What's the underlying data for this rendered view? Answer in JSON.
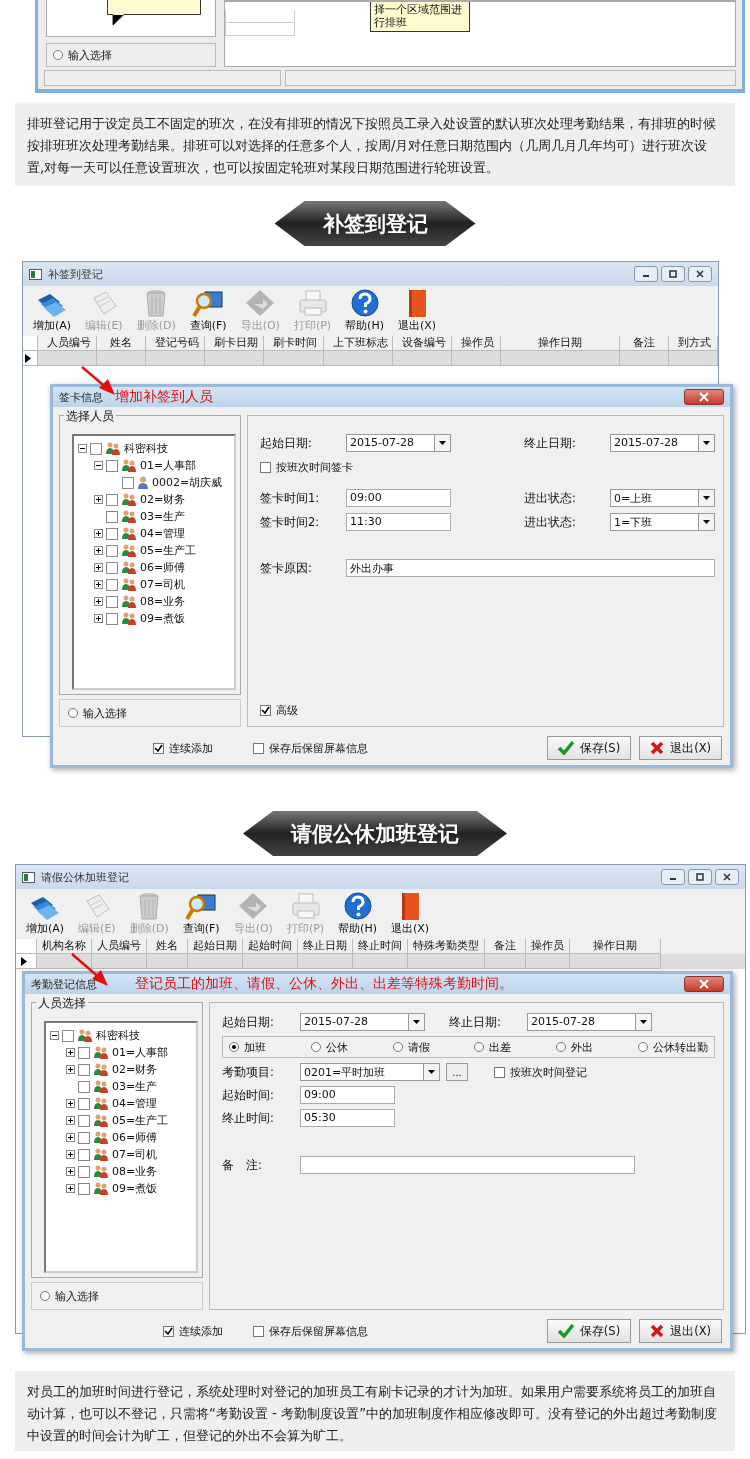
{
  "top_fragment": {
    "callout": "择一个区域范围进行排班",
    "input_select": {
      "label": "输入选择",
      "selected": false
    }
  },
  "intro_text": "排班登记用于设定员工不固定的班次，在没有排班的情况下按照员工录入处设置的默认班次处理考勤结果，有排班的时候按排班班次处理考勤结果。排班可以对选择的任意多个人，按周/月对任意日期范围内（几周几月几年均可）进行班次设置,对每一天可以任意设置班次，也可以按固定轮班对某段日期范围进行轮班设置。",
  "sections": [
    {
      "banner": "补签到登记",
      "window": {
        "title": "补签到登记",
        "toolbar": [
          {
            "kind": "add",
            "label": "增加(A)",
            "disabled": false
          },
          {
            "kind": "edit",
            "label": "编辑(E)",
            "disabled": true
          },
          {
            "kind": "delete",
            "label": "删除(D)",
            "disabled": true
          },
          {
            "kind": "query",
            "label": "查询(F)",
            "disabled": false
          },
          {
            "kind": "export",
            "label": "导出(O)",
            "disabled": true
          },
          {
            "kind": "print",
            "label": "打印(P)",
            "disabled": true
          },
          {
            "kind": "help",
            "label": "帮助(H)",
            "disabled": false
          },
          {
            "kind": "exit",
            "label": "退出(X)",
            "disabled": false
          }
        ],
        "columns": [
          "人员编号",
          "姓名",
          "登记号码",
          "刷卡日期",
          "刷卡时间",
          "上下班标志",
          "设备编号",
          "操作员",
          "操作日期",
          "备注",
          "到方式"
        ]
      },
      "dialog": {
        "title": "签卡信息",
        "annotation": "增加补签到人员",
        "group_label": "选择人员",
        "tree": [
          {
            "label": "科密科技",
            "kind": "dept",
            "expanded": true,
            "checked": false,
            "children": [
              {
                "label": "01=人事部",
                "kind": "dept",
                "expanded": true,
                "checked": false,
                "children": [
                  {
                    "label": "0002=胡庆威",
                    "kind": "person",
                    "checked": false
                  }
                ]
              },
              {
                "label": "02=财务",
                "kind": "dept",
                "expanded": false,
                "checked": false
              },
              {
                "label": "03=生产",
                "kind": "empty_dept",
                "checked": false
              },
              {
                "label": "04=管理",
                "kind": "dept",
                "expanded": false,
                "checked": false
              },
              {
                "label": "05=生产工",
                "kind": "dept",
                "expanded": false,
                "checked": false
              },
              {
                "label": "06=师傅",
                "kind": "dept",
                "expanded": false,
                "checked": false
              },
              {
                "label": "07=司机",
                "kind": "dept",
                "expanded": false,
                "checked": false
              },
              {
                "label": "08=业务",
                "kind": "dept",
                "expanded": false,
                "checked": false
              },
              {
                "label": "09=煮饭",
                "kind": "dept",
                "expanded": false,
                "checked": false
              }
            ]
          }
        ],
        "input_select": {
          "label": "输入选择",
          "selected": false
        },
        "rows": [
          {
            "kind": "pairs",
            "items": [
              {
                "kind": "label",
                "text": "起始日期:"
              },
              {
                "kind": "combo",
                "value": "2015-07-28"
              },
              {
                "kind": "label",
                "text": "终止日期:"
              },
              {
                "kind": "combo",
                "value": "2015-07-28"
              }
            ]
          },
          {
            "kind": "check",
            "items": [
              {
                "kind": "check",
                "label": "按班次时间签卡",
                "checked": false
              }
            ]
          },
          {
            "kind": "pairs",
            "items": [
              {
                "kind": "label",
                "text": "签卡时间1:"
              },
              {
                "kind": "text",
                "value": "09:00"
              },
              {
                "kind": "label",
                "text": "进出状态:"
              },
              {
                "kind": "select",
                "value": "0=上班"
              }
            ]
          },
          {
            "kind": "pairs",
            "items": [
              {
                "kind": "label",
                "text": "签卡时间2:"
              },
              {
                "kind": "text",
                "value": "11:30"
              },
              {
                "kind": "label",
                "text": "进出状态:"
              },
              {
                "kind": "select",
                "value": "1=下班"
              }
            ]
          },
          {
            "kind": "wide",
            "items": [
              {
                "kind": "label",
                "text": "签卡原因:"
              },
              {
                "kind": "text",
                "value": "外出办事"
              }
            ]
          },
          {
            "kind": "bottom",
            "items": [
              {
                "kind": "check",
                "label": "高级",
                "checked": true
              }
            ]
          }
        ],
        "footer_checks": [
          {
            "label": "连续添加",
            "checked": true
          },
          {
            "label": "保存后保留屏幕信息",
            "checked": false
          }
        ],
        "buttons": [
          {
            "kind": "save",
            "label": "保存(S)"
          },
          {
            "kind": "exit",
            "label": "退出(X)"
          }
        ]
      }
    },
    {
      "banner": "请假公休加班登记",
      "window": {
        "title": "请假公休加班登记",
        "toolbar": [
          {
            "kind": "add",
            "label": "增加(A)",
            "disabled": false
          },
          {
            "kind": "edit",
            "label": "编辑(E)",
            "disabled": true
          },
          {
            "kind": "delete",
            "label": "删除(D)",
            "disabled": true
          },
          {
            "kind": "query",
            "label": "查询(F)",
            "disabled": false
          },
          {
            "kind": "export",
            "label": "导出(O)",
            "disabled": true
          },
          {
            "kind": "print",
            "label": "打印(P)",
            "disabled": true
          },
          {
            "kind": "help",
            "label": "帮助(H)",
            "disabled": false
          },
          {
            "kind": "exit",
            "label": "退出(X)",
            "disabled": false
          }
        ],
        "columns": [
          "机构名称",
          "人员编号",
          "姓名",
          "起始日期",
          "起始时间",
          "终止日期",
          "终止时间",
          "特殊考勤类型",
          "备注",
          "操作员",
          "操作日期"
        ]
      },
      "dialog": {
        "title": "考勤登记信息",
        "annotation": "登记员工的加班、请假、公休、外出、出差等特殊考勤时间。",
        "group_label": "人员选择",
        "tree": [
          {
            "label": "科密科技",
            "kind": "dept",
            "expanded": true,
            "checked": false,
            "children": [
              {
                "label": "01=人事部",
                "kind": "dept",
                "expanded": false,
                "checked": false
              },
              {
                "label": "02=财务",
                "kind": "dept",
                "expanded": false,
                "checked": false
              },
              {
                "label": "03=生产",
                "kind": "empty_dept",
                "checked": false
              },
              {
                "label": "04=管理",
                "kind": "dept",
                "expanded": false,
                "checked": false
              },
              {
                "label": "05=生产工",
                "kind": "dept",
                "expanded": false,
                "checked": false
              },
              {
                "label": "06=师傅",
                "kind": "dept",
                "expanded": false,
                "checked": false
              },
              {
                "label": "07=司机",
                "kind": "dept",
                "expanded": false,
                "checked": false
              },
              {
                "label": "08=业务",
                "kind": "dept",
                "expanded": false,
                "checked": false
              },
              {
                "label": "09=煮饭",
                "kind": "dept",
                "expanded": false,
                "checked": false
              }
            ]
          }
        ],
        "input_select": {
          "label": "输入选择",
          "selected": false
        },
        "rows": [
          {
            "kind": "inline",
            "items": [
              {
                "kind": "label",
                "text": "起始日期:"
              },
              {
                "kind": "combo",
                "value": "2015-07-28"
              },
              {
                "kind": "label",
                "text": "终止日期:"
              },
              {
                "kind": "combo",
                "value": "2015-07-28"
              }
            ]
          },
          {
            "kind": "radios",
            "items": [
              {
                "kind": "radio",
                "label": "加班",
                "selected": true
              },
              {
                "kind": "radio",
                "label": "公休",
                "selected": false
              },
              {
                "kind": "radio",
                "label": "请假",
                "selected": false
              },
              {
                "kind": "radio",
                "label": "出差",
                "selected": false
              },
              {
                "kind": "radio",
                "label": "外出",
                "selected": false
              },
              {
                "kind": "radio",
                "label": "公休转出勤",
                "selected": false
              }
            ]
          },
          {
            "kind": "line",
            "items": [
              {
                "kind": "label",
                "text": "考勤项目:"
              },
              {
                "kind": "select",
                "value": "0201=平时加班"
              },
              {
                "kind": "ellipsis",
                "text": "..."
              },
              {
                "kind": "check",
                "label": "按班次时间登记",
                "checked": false
              }
            ]
          },
          {
            "kind": "line",
            "items": [
              {
                "kind": "label",
                "text": "起始时间:"
              },
              {
                "kind": "text",
                "value": "09:00"
              }
            ]
          },
          {
            "kind": "line",
            "items": [
              {
                "kind": "label",
                "text": "终止时间:"
              },
              {
                "kind": "text",
                "value": "05:30"
              }
            ]
          },
          {
            "kind": "wide",
            "items": [
              {
                "kind": "label",
                "text": "备　注:"
              },
              {
                "kind": "text"
              }
            ]
          }
        ],
        "footer_checks": [
          {
            "label": "连续添加",
            "checked": true
          },
          {
            "label": "保存后保留屏幕信息",
            "checked": false
          }
        ],
        "buttons": [
          {
            "kind": "save",
            "label": "保存(S)"
          },
          {
            "kind": "exit",
            "label": "退出(X)"
          }
        ]
      }
    }
  ],
  "outro_text": "对员工的加班时间进行登记，系统处理时对登记的加班员工有刷卡记录的才计为加班。如果用户需要系统将员工的加班自动计算，也可以不登记，只需将“考勤设置 - 考勤制度设置”中的加班制度作相应修改即可。没有登记的外出超过考勤制度中设置的时间会计为旷工，但登记的外出不会算为旷工。"
}
